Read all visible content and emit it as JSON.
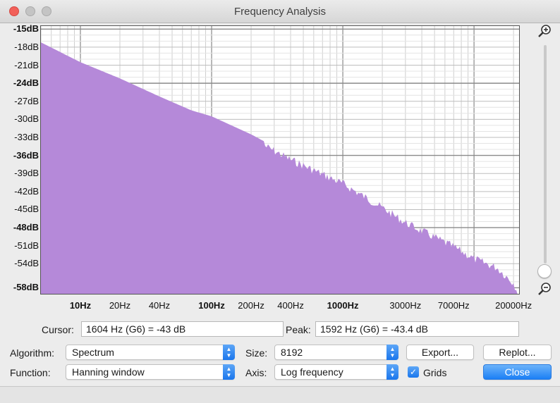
{
  "window": {
    "title": "Frequency Analysis"
  },
  "chart_data": {
    "type": "area",
    "scale_x": "log",
    "x_range_hz": [
      5,
      22050
    ],
    "y_range_db": [
      -59,
      -14.5
    ],
    "color": "#b589d9",
    "y_ticks": [
      {
        "label": "-15dB",
        "db": -15,
        "bold": true
      },
      {
        "label": "-18dB",
        "db": -18,
        "bold": false
      },
      {
        "label": "-21dB",
        "db": -21,
        "bold": false
      },
      {
        "label": "-24dB",
        "db": -24,
        "bold": true
      },
      {
        "label": "-27dB",
        "db": -27,
        "bold": false
      },
      {
        "label": "-30dB",
        "db": -30,
        "bold": false
      },
      {
        "label": "-33dB",
        "db": -33,
        "bold": false
      },
      {
        "label": "-36dB",
        "db": -36,
        "bold": true
      },
      {
        "label": "-39dB",
        "db": -39,
        "bold": false
      },
      {
        "label": "-42dB",
        "db": -42,
        "bold": false
      },
      {
        "label": "-45dB",
        "db": -45,
        "bold": false
      },
      {
        "label": "-48dB",
        "db": -48,
        "bold": true
      },
      {
        "label": "-51dB",
        "db": -51,
        "bold": false
      },
      {
        "label": "-54dB",
        "db": -54,
        "bold": false
      },
      {
        "label": "-58dB",
        "db": -58,
        "bold": true
      }
    ],
    "x_ticks": [
      {
        "label": "10Hz",
        "hz": 10,
        "bold": true
      },
      {
        "label": "20Hz",
        "hz": 20,
        "bold": false
      },
      {
        "label": "40Hz",
        "hz": 40,
        "bold": false
      },
      {
        "label": "100Hz",
        "hz": 100,
        "bold": true
      },
      {
        "label": "200Hz",
        "hz": 200,
        "bold": false
      },
      {
        "label": "400Hz",
        "hz": 400,
        "bold": false
      },
      {
        "label": "1000Hz",
        "hz": 1000,
        "bold": true
      },
      {
        "label": "3000Hz",
        "hz": 3000,
        "bold": false
      },
      {
        "label": "7000Hz",
        "hz": 7000,
        "bold": false
      },
      {
        "label": "20000Hz",
        "hz": 20000,
        "bold": false
      }
    ],
    "points": [
      {
        "hz": 5,
        "db": -17.2
      },
      {
        "hz": 10,
        "db": -20.5
      },
      {
        "hz": 20,
        "db": -23.2
      },
      {
        "hz": 40,
        "db": -26.2
      },
      {
        "hz": 70,
        "db": -28.5
      },
      {
        "hz": 100,
        "db": -29.5
      },
      {
        "hz": 200,
        "db": -32.5
      },
      {
        "hz": 400,
        "db": -36.0
      },
      {
        "hz": 1000,
        "db": -40.0
      },
      {
        "hz": 2000,
        "db": -44.0
      },
      {
        "hz": 3000,
        "db": -46.5
      },
      {
        "hz": 7000,
        "db": -50.5
      },
      {
        "hz": 10000,
        "db": -52.5
      },
      {
        "hz": 15000,
        "db": -54.0
      },
      {
        "hz": 20000,
        "db": -56.5
      },
      {
        "hz": 22050,
        "db": -58.5
      }
    ]
  },
  "readouts": {
    "cursor_label": "Cursor:",
    "cursor_value": "1604 Hz (G6) = -43 dB",
    "peak_label": "Peak:",
    "peak_value": "1592 Hz (G6) = -43.4 dB"
  },
  "controls": {
    "algorithm_label": "Algorithm:",
    "algorithm_value": "Spectrum",
    "function_label": "Function:",
    "function_value": "Hanning window",
    "size_label": "Size:",
    "size_value": "8192",
    "axis_label": "Axis:",
    "axis_value": "Log frequency",
    "export_label": "Export...",
    "replot_label": "Replot...",
    "grids_label": "Grids",
    "grids_checked": true,
    "close_label": "Close"
  }
}
